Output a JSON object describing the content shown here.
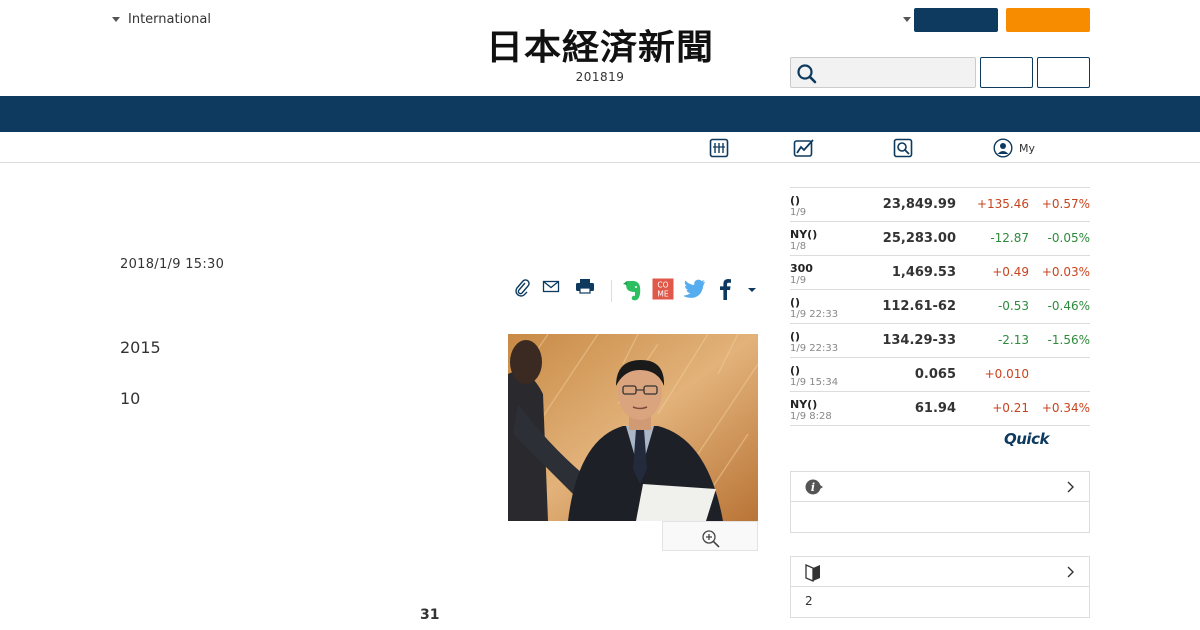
{
  "header": {
    "edition_label": "International",
    "masthead_logo": "日本経済新聞",
    "masthead_date": "201819",
    "search_placeholder": "",
    "navy_button_label": "",
    "orange_button_label": "",
    "login_button_label": "",
    "signup_button_label": ""
  },
  "subnav": {
    "items": [
      {
        "label": "",
        "icon": "newspaper-icon"
      },
      {
        "label": "",
        "icon": "chart-icon"
      },
      {
        "label": "",
        "icon": "search-icon"
      },
      {
        "label": "My",
        "icon": "user-icon"
      }
    ]
  },
  "article": {
    "date": "2018/1/9 15:30",
    "paragraphs": [
      "2015",
      "10"
    ],
    "page_number": "31",
    "share_icons": [
      "paperclip-icon",
      "mail-icon",
      "print-icon",
      "evernote-icon",
      "come-icon",
      "twitter-icon",
      "facebook-icon",
      "more-caret-icon"
    ]
  },
  "markets": {
    "rows": [
      {
        "name": "()",
        "time": "1/9",
        "value": "23,849.99",
        "change": "+135.46",
        "percent": "+0.57%",
        "dir": "up"
      },
      {
        "name": "NY()",
        "time": "1/8",
        "value": "25,283.00",
        "change": "-12.87",
        "percent": "-0.05%",
        "dir": "down"
      },
      {
        "name": "300",
        "time": "1/9",
        "value": "1,469.53",
        "change": "+0.49",
        "percent": "+0.03%",
        "dir": "up"
      },
      {
        "name": "()",
        "time": "1/9 22:33",
        "value": "112.61-62",
        "change": "-0.53",
        "percent": "-0.46%",
        "dir": "down"
      },
      {
        "name": "()",
        "time": "1/9 22:33",
        "value": "134.29-33",
        "change": "-2.13",
        "percent": "-1.56%",
        "dir": "down"
      },
      {
        "name": "()",
        "time": "1/9 15:34",
        "value": "0.065",
        "change": "+0.010",
        "percent": "",
        "dir": "up"
      },
      {
        "name": "NY()",
        "time": "1/9 8:28",
        "value": "61.94",
        "change": "+0.21",
        "percent": "+0.34%",
        "dir": "up"
      }
    ],
    "provider": "Quick"
  },
  "panels": [
    {
      "icon": "info-icon",
      "body": ""
    },
    {
      "icon": "beginner-mark-icon",
      "body": "2"
    }
  ],
  "colors": {
    "navy": "#0d3a5e",
    "orange": "#f78c00",
    "up": "#c8441e",
    "down": "#2e8b3c"
  }
}
